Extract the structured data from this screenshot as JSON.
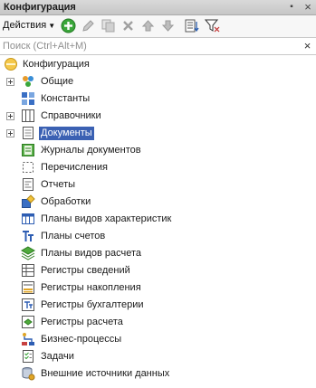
{
  "window": {
    "title": "Конфигурация",
    "pin_glyph": "▪",
    "close_glyph": "×"
  },
  "toolbar": {
    "actions_label": "Действия",
    "actions_caret": "▼",
    "buttons": [
      "add-icon",
      "edit-icon",
      "copy-icon",
      "delete-icon",
      "move-up-icon",
      "move-down-icon",
      "sort-icon",
      "filter-icon"
    ]
  },
  "search": {
    "placeholder": "Поиск (Ctrl+Alt+M)",
    "value": "",
    "clear_glyph": "×"
  },
  "tree": {
    "root": {
      "label": "Конфигурация",
      "icon": "configuration-icon"
    },
    "items": [
      {
        "label": "Общие",
        "icon": "common-icon",
        "expandable": true
      },
      {
        "label": "Константы",
        "icon": "constants-icon",
        "expandable": false
      },
      {
        "label": "Справочники",
        "icon": "catalogs-icon",
        "expandable": true
      },
      {
        "label": "Документы",
        "icon": "documents-icon",
        "expandable": true,
        "selected": true
      },
      {
        "label": "Журналы документов",
        "icon": "document-journals-icon"
      },
      {
        "label": "Перечисления",
        "icon": "enumerations-icon"
      },
      {
        "label": "Отчеты",
        "icon": "reports-icon"
      },
      {
        "label": "Обработки",
        "icon": "data-processors-icon"
      },
      {
        "label": "Планы видов характеристик",
        "icon": "chart-of-characteristic-types-icon"
      },
      {
        "label": "Планы счетов",
        "icon": "chart-of-accounts-icon"
      },
      {
        "label": "Планы видов расчета",
        "icon": "chart-of-calculation-types-icon"
      },
      {
        "label": "Регистры сведений",
        "icon": "information-registers-icon"
      },
      {
        "label": "Регистры накопления",
        "icon": "accumulation-registers-icon"
      },
      {
        "label": "Регистры бухгалтерии",
        "icon": "accounting-registers-icon"
      },
      {
        "label": "Регистры расчета",
        "icon": "calculation-registers-icon"
      },
      {
        "label": "Бизнес-процессы",
        "icon": "business-processes-icon"
      },
      {
        "label": "Задачи",
        "icon": "tasks-icon"
      },
      {
        "label": "Внешние источники данных",
        "icon": "external-data-sources-icon"
      }
    ]
  },
  "colors": {
    "selection": "#3b61b3",
    "accent_green": "#2f9e2f",
    "titlebar": "#cfcfcf"
  }
}
